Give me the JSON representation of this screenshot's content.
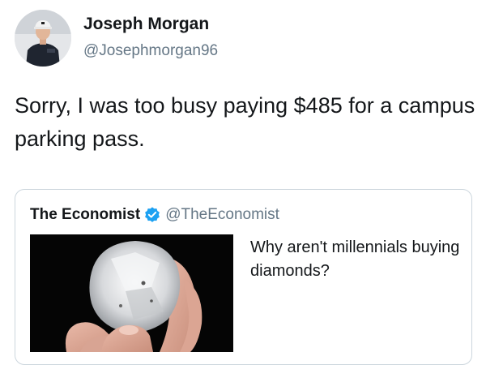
{
  "tweet": {
    "author": {
      "name": "Joseph Morgan",
      "handle": "@Josephmorgan96",
      "avatar_icon": "profile-photo"
    },
    "text": "Sorry, I was too busy paying $485 for a campus parking pass."
  },
  "quoted_tweet": {
    "author": {
      "name": "The Economist",
      "handle": "@TheEconomist",
      "verified": true,
      "verified_icon": "verified-badge-icon"
    },
    "text": "Why aren't millennials buying diamonds?",
    "media": {
      "description_icon": "diamond-in-hand-photo"
    }
  },
  "colors": {
    "text": "#14171a",
    "secondary_text": "#657786",
    "border": "#ccd6dd",
    "verified": "#1da1f2"
  }
}
